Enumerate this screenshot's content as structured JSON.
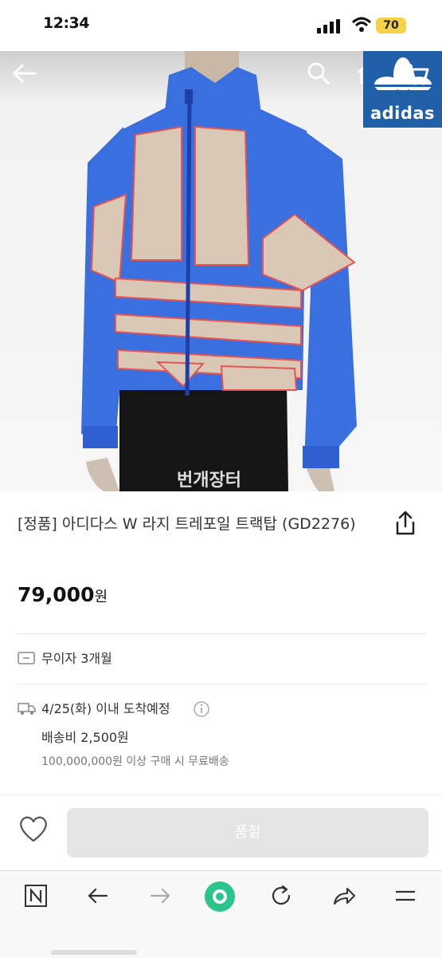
{
  "status_bar": {
    "time": "12:34",
    "battery": "70"
  },
  "hero": {
    "brand_logo_text": "adidas",
    "watermark": "번개장터"
  },
  "product": {
    "title": "[정품] 아디다스 W 라지 트레포일 트랙탑 (GD2276)",
    "price": "79,000",
    "price_unit": "원"
  },
  "payment": {
    "installment": "무이자 3개월"
  },
  "delivery": {
    "eta": "4/25(화) 이내 도착예정",
    "fee": "배송비 2,500원",
    "free_shipping": "100,000,000원 이상 구매 시 무료배송"
  },
  "actions": {
    "soldout_label": "품절"
  },
  "colors": {
    "jacket_blue": "#3a6fe0",
    "jacket_beige": "#d9c8b6",
    "piping_red": "#e8544f",
    "logo_bg": "#2160a8",
    "browser_green": "#2bc48a"
  },
  "icons": [
    "back-arrow-icon",
    "search-icon",
    "home-icon",
    "cart-icon",
    "share-icon",
    "card-icon",
    "truck-icon",
    "info-icon",
    "heart-icon",
    "naver-icon",
    "browser-back-icon",
    "browser-forward-icon",
    "browser-home-icon",
    "refresh-icon",
    "browser-share-icon",
    "menu-icon"
  ]
}
